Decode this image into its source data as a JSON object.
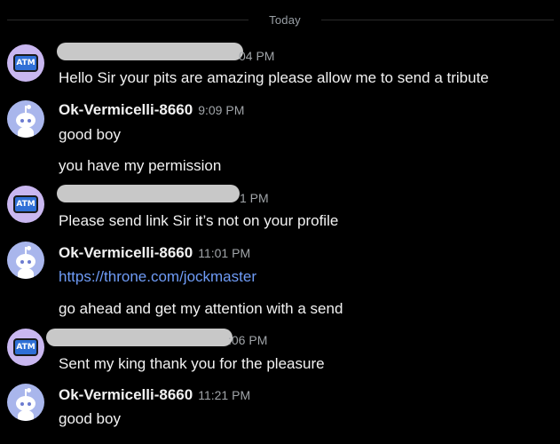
{
  "divider": {
    "label": "Today"
  },
  "colors": {
    "background": "#000000",
    "text": "#f2f2f2",
    "muted": "#a0a4a8",
    "link": "#6f9cf7",
    "atm_avatar_bg": "#c9b7f0",
    "snoo_avatar_bg": "#a9b6ec"
  },
  "messages": [
    {
      "avatar": "atm-icon",
      "avatar_text": "ATM",
      "username_redacted": true,
      "time_visible": "04 PM",
      "lines": [
        "Hello Sir your pits are amazing please allow me to send a tribute"
      ]
    },
    {
      "avatar": "reddit-snoo-icon",
      "username": "Ok-Vermicelli-8660",
      "time": "9:09 PM",
      "lines": [
        "good boy",
        "you have my permission"
      ]
    },
    {
      "avatar": "atm-icon",
      "avatar_text": "ATM",
      "username_redacted": true,
      "time_visible": "1 PM",
      "lines": [
        "Please send link Sir it’s not on your profile"
      ]
    },
    {
      "avatar": "reddit-snoo-icon",
      "username": "Ok-Vermicelli-8660",
      "time": "11:01 PM",
      "link": "https://throne.com/jockmaster",
      "lines": [
        "go ahead and get my attention with a send"
      ]
    },
    {
      "avatar": "atm-icon",
      "avatar_text": "ATM",
      "username_redacted": true,
      "time_visible": ":06 PM",
      "lines": [
        "Sent my king thank you for the pleasure"
      ]
    },
    {
      "avatar": "reddit-snoo-icon",
      "username": "Ok-Vermicelli-8660",
      "time": "11:21 PM",
      "lines": [
        "good boy"
      ]
    }
  ]
}
